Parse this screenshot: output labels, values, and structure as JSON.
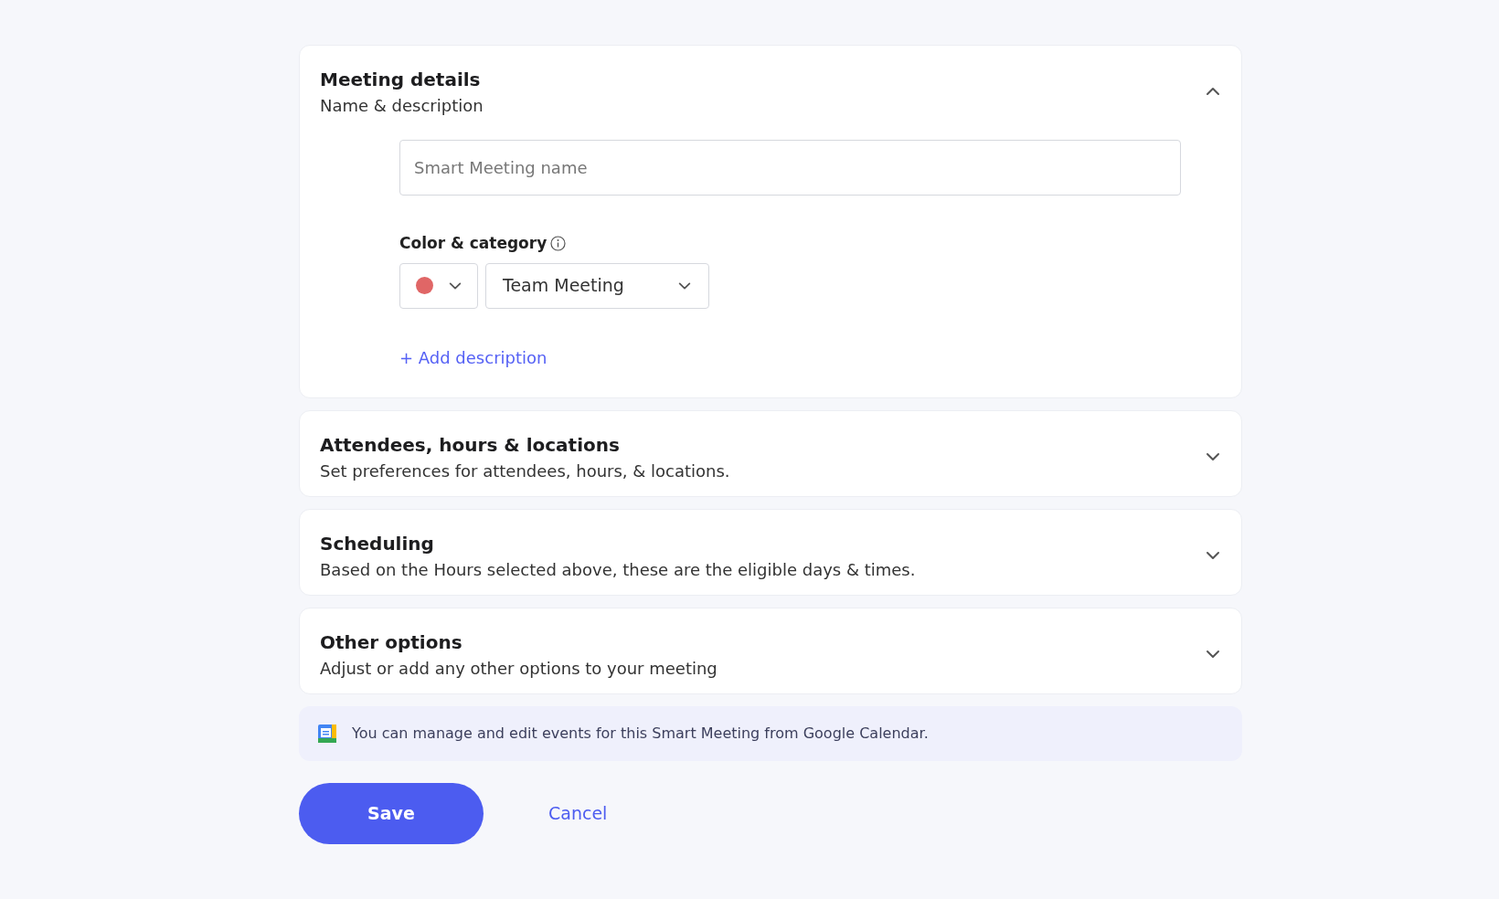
{
  "sections": [
    {
      "title": "Meeting details",
      "subtitle": "Name & description",
      "expanded": true
    },
    {
      "title": "Attendees, hours & locations",
      "subtitle": "Set preferences for attendees, hours, & locations.",
      "expanded": false
    },
    {
      "title": "Scheduling",
      "subtitle": "Based on the Hours selected above, these are the eligible days & times.",
      "expanded": false
    },
    {
      "title": "Other options",
      "subtitle": "Adjust or add any other options to your meeting",
      "expanded": false
    }
  ],
  "meeting_details": {
    "name_placeholder": "Smart Meeting name",
    "color_category_label": "Color & category",
    "color": "#e06666",
    "category": "Team Meeting",
    "add_description": "+ Add description"
  },
  "notice": "You can manage and edit events for this Smart Meeting from Google Calendar.",
  "buttons": {
    "save": "Save",
    "cancel": "Cancel"
  }
}
